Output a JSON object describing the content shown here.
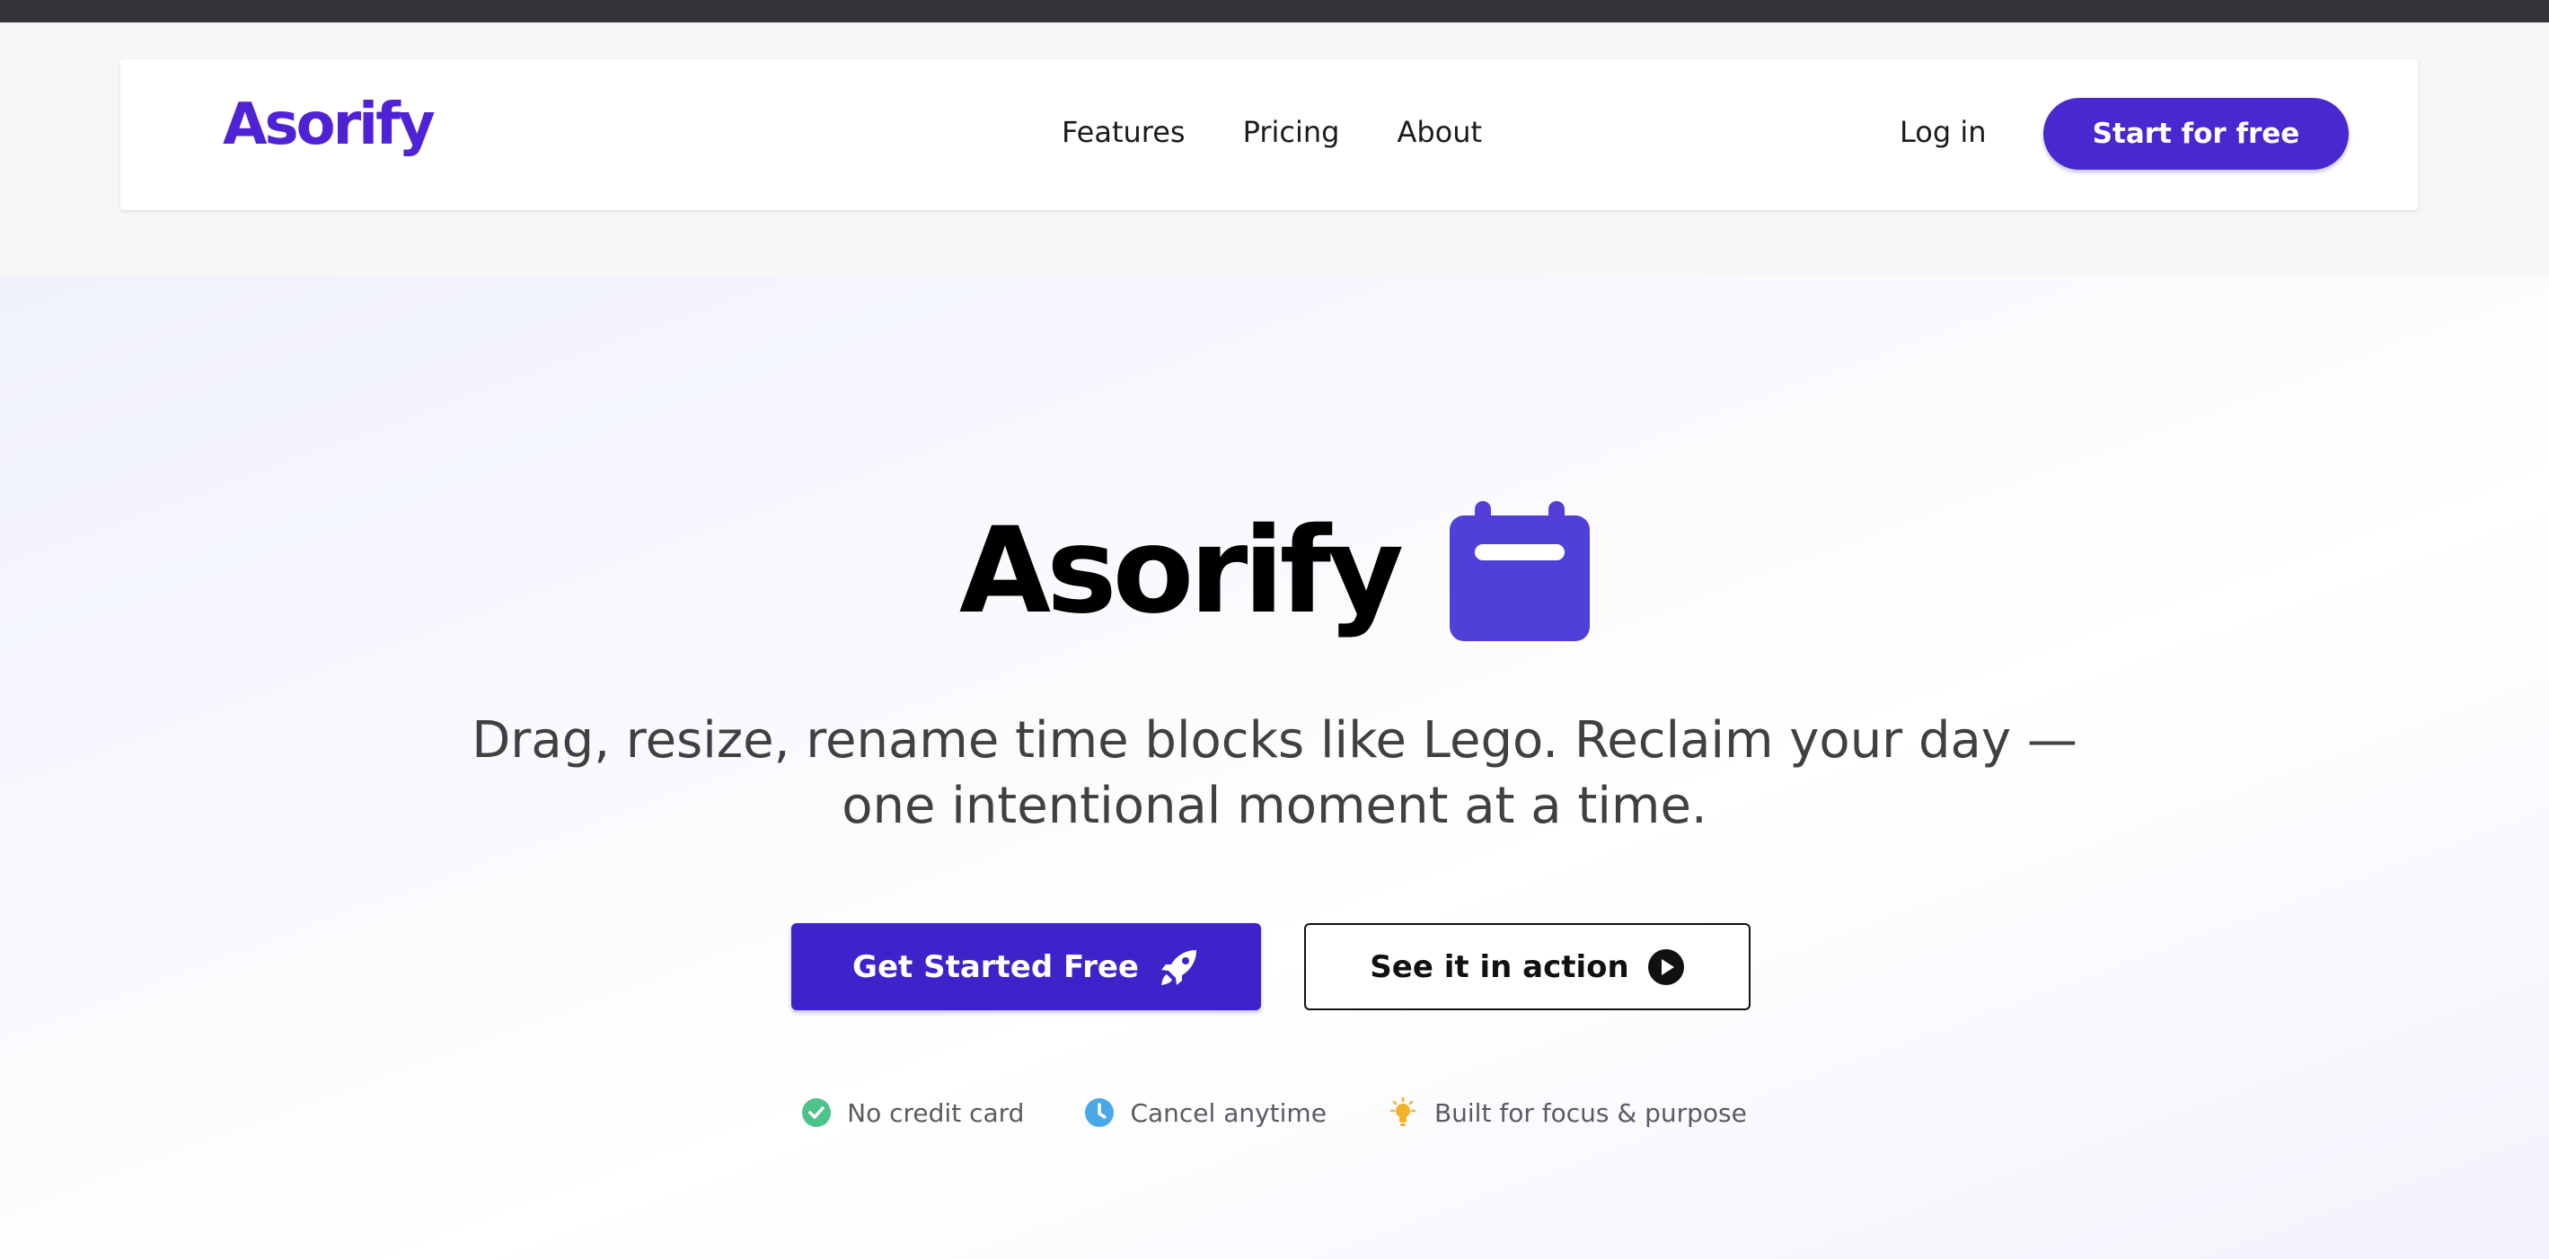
{
  "header": {
    "brand": "Asorify",
    "nav": [
      {
        "label": "Features"
      },
      {
        "label": "Pricing"
      },
      {
        "label": "About"
      }
    ],
    "login_label": "Log in",
    "cta_label": "Start for free"
  },
  "hero": {
    "title": "Asorify",
    "title_icon": "calendar-icon",
    "subtitle": "Drag, resize, rename time blocks like Lego. Reclaim your day — one intentional moment at a time.",
    "primary_button": {
      "label": "Get Started Free",
      "icon": "rocket-icon"
    },
    "secondary_button": {
      "label": "See it in action",
      "icon": "play-circle-icon"
    },
    "features": [
      {
        "label": "No credit card",
        "icon": "check-circle-icon",
        "color": "#4cc38a"
      },
      {
        "label": "Cancel anytime",
        "icon": "clock-icon",
        "color": "#4aa8e8"
      },
      {
        "label": "Built for focus & purpose",
        "icon": "lightbulb-icon",
        "color": "#f2b32a"
      }
    ]
  },
  "colors": {
    "brand": "#4f22d6",
    "primary": "#3d23c9",
    "calendar": "#5040d8",
    "browser_bar": "#34353a"
  }
}
